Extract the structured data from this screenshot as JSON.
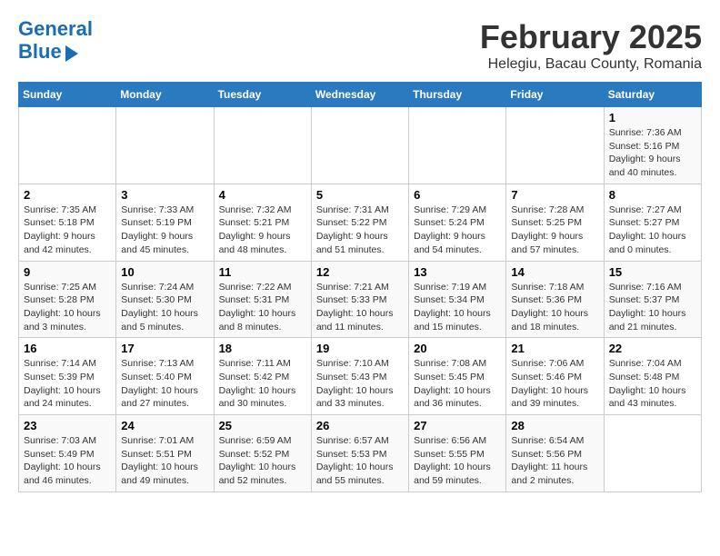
{
  "logo": {
    "line1": "General",
    "line2": "Blue"
  },
  "title": "February 2025",
  "subtitle": "Helegiu, Bacau County, Romania",
  "days_of_week": [
    "Sunday",
    "Monday",
    "Tuesday",
    "Wednesday",
    "Thursday",
    "Friday",
    "Saturday"
  ],
  "weeks": [
    [
      {
        "day": "",
        "info": ""
      },
      {
        "day": "",
        "info": ""
      },
      {
        "day": "",
        "info": ""
      },
      {
        "day": "",
        "info": ""
      },
      {
        "day": "",
        "info": ""
      },
      {
        "day": "",
        "info": ""
      },
      {
        "day": "1",
        "info": "Sunrise: 7:36 AM\nSunset: 5:16 PM\nDaylight: 9 hours and 40 minutes."
      }
    ],
    [
      {
        "day": "2",
        "info": "Sunrise: 7:35 AM\nSunset: 5:18 PM\nDaylight: 9 hours and 42 minutes."
      },
      {
        "day": "3",
        "info": "Sunrise: 7:33 AM\nSunset: 5:19 PM\nDaylight: 9 hours and 45 minutes."
      },
      {
        "day": "4",
        "info": "Sunrise: 7:32 AM\nSunset: 5:21 PM\nDaylight: 9 hours and 48 minutes."
      },
      {
        "day": "5",
        "info": "Sunrise: 7:31 AM\nSunset: 5:22 PM\nDaylight: 9 hours and 51 minutes."
      },
      {
        "day": "6",
        "info": "Sunrise: 7:29 AM\nSunset: 5:24 PM\nDaylight: 9 hours and 54 minutes."
      },
      {
        "day": "7",
        "info": "Sunrise: 7:28 AM\nSunset: 5:25 PM\nDaylight: 9 hours and 57 minutes."
      },
      {
        "day": "8",
        "info": "Sunrise: 7:27 AM\nSunset: 5:27 PM\nDaylight: 10 hours and 0 minutes."
      }
    ],
    [
      {
        "day": "9",
        "info": "Sunrise: 7:25 AM\nSunset: 5:28 PM\nDaylight: 10 hours and 3 minutes."
      },
      {
        "day": "10",
        "info": "Sunrise: 7:24 AM\nSunset: 5:30 PM\nDaylight: 10 hours and 5 minutes."
      },
      {
        "day": "11",
        "info": "Sunrise: 7:22 AM\nSunset: 5:31 PM\nDaylight: 10 hours and 8 minutes."
      },
      {
        "day": "12",
        "info": "Sunrise: 7:21 AM\nSunset: 5:33 PM\nDaylight: 10 hours and 11 minutes."
      },
      {
        "day": "13",
        "info": "Sunrise: 7:19 AM\nSunset: 5:34 PM\nDaylight: 10 hours and 15 minutes."
      },
      {
        "day": "14",
        "info": "Sunrise: 7:18 AM\nSunset: 5:36 PM\nDaylight: 10 hours and 18 minutes."
      },
      {
        "day": "15",
        "info": "Sunrise: 7:16 AM\nSunset: 5:37 PM\nDaylight: 10 hours and 21 minutes."
      }
    ],
    [
      {
        "day": "16",
        "info": "Sunrise: 7:14 AM\nSunset: 5:39 PM\nDaylight: 10 hours and 24 minutes."
      },
      {
        "day": "17",
        "info": "Sunrise: 7:13 AM\nSunset: 5:40 PM\nDaylight: 10 hours and 27 minutes."
      },
      {
        "day": "18",
        "info": "Sunrise: 7:11 AM\nSunset: 5:42 PM\nDaylight: 10 hours and 30 minutes."
      },
      {
        "day": "19",
        "info": "Sunrise: 7:10 AM\nSunset: 5:43 PM\nDaylight: 10 hours and 33 minutes."
      },
      {
        "day": "20",
        "info": "Sunrise: 7:08 AM\nSunset: 5:45 PM\nDaylight: 10 hours and 36 minutes."
      },
      {
        "day": "21",
        "info": "Sunrise: 7:06 AM\nSunset: 5:46 PM\nDaylight: 10 hours and 39 minutes."
      },
      {
        "day": "22",
        "info": "Sunrise: 7:04 AM\nSunset: 5:48 PM\nDaylight: 10 hours and 43 minutes."
      }
    ],
    [
      {
        "day": "23",
        "info": "Sunrise: 7:03 AM\nSunset: 5:49 PM\nDaylight: 10 hours and 46 minutes."
      },
      {
        "day": "24",
        "info": "Sunrise: 7:01 AM\nSunset: 5:51 PM\nDaylight: 10 hours and 49 minutes."
      },
      {
        "day": "25",
        "info": "Sunrise: 6:59 AM\nSunset: 5:52 PM\nDaylight: 10 hours and 52 minutes."
      },
      {
        "day": "26",
        "info": "Sunrise: 6:57 AM\nSunset: 5:53 PM\nDaylight: 10 hours and 55 minutes."
      },
      {
        "day": "27",
        "info": "Sunrise: 6:56 AM\nSunset: 5:55 PM\nDaylight: 10 hours and 59 minutes."
      },
      {
        "day": "28",
        "info": "Sunrise: 6:54 AM\nSunset: 5:56 PM\nDaylight: 11 hours and 2 minutes."
      },
      {
        "day": "",
        "info": ""
      }
    ]
  ]
}
